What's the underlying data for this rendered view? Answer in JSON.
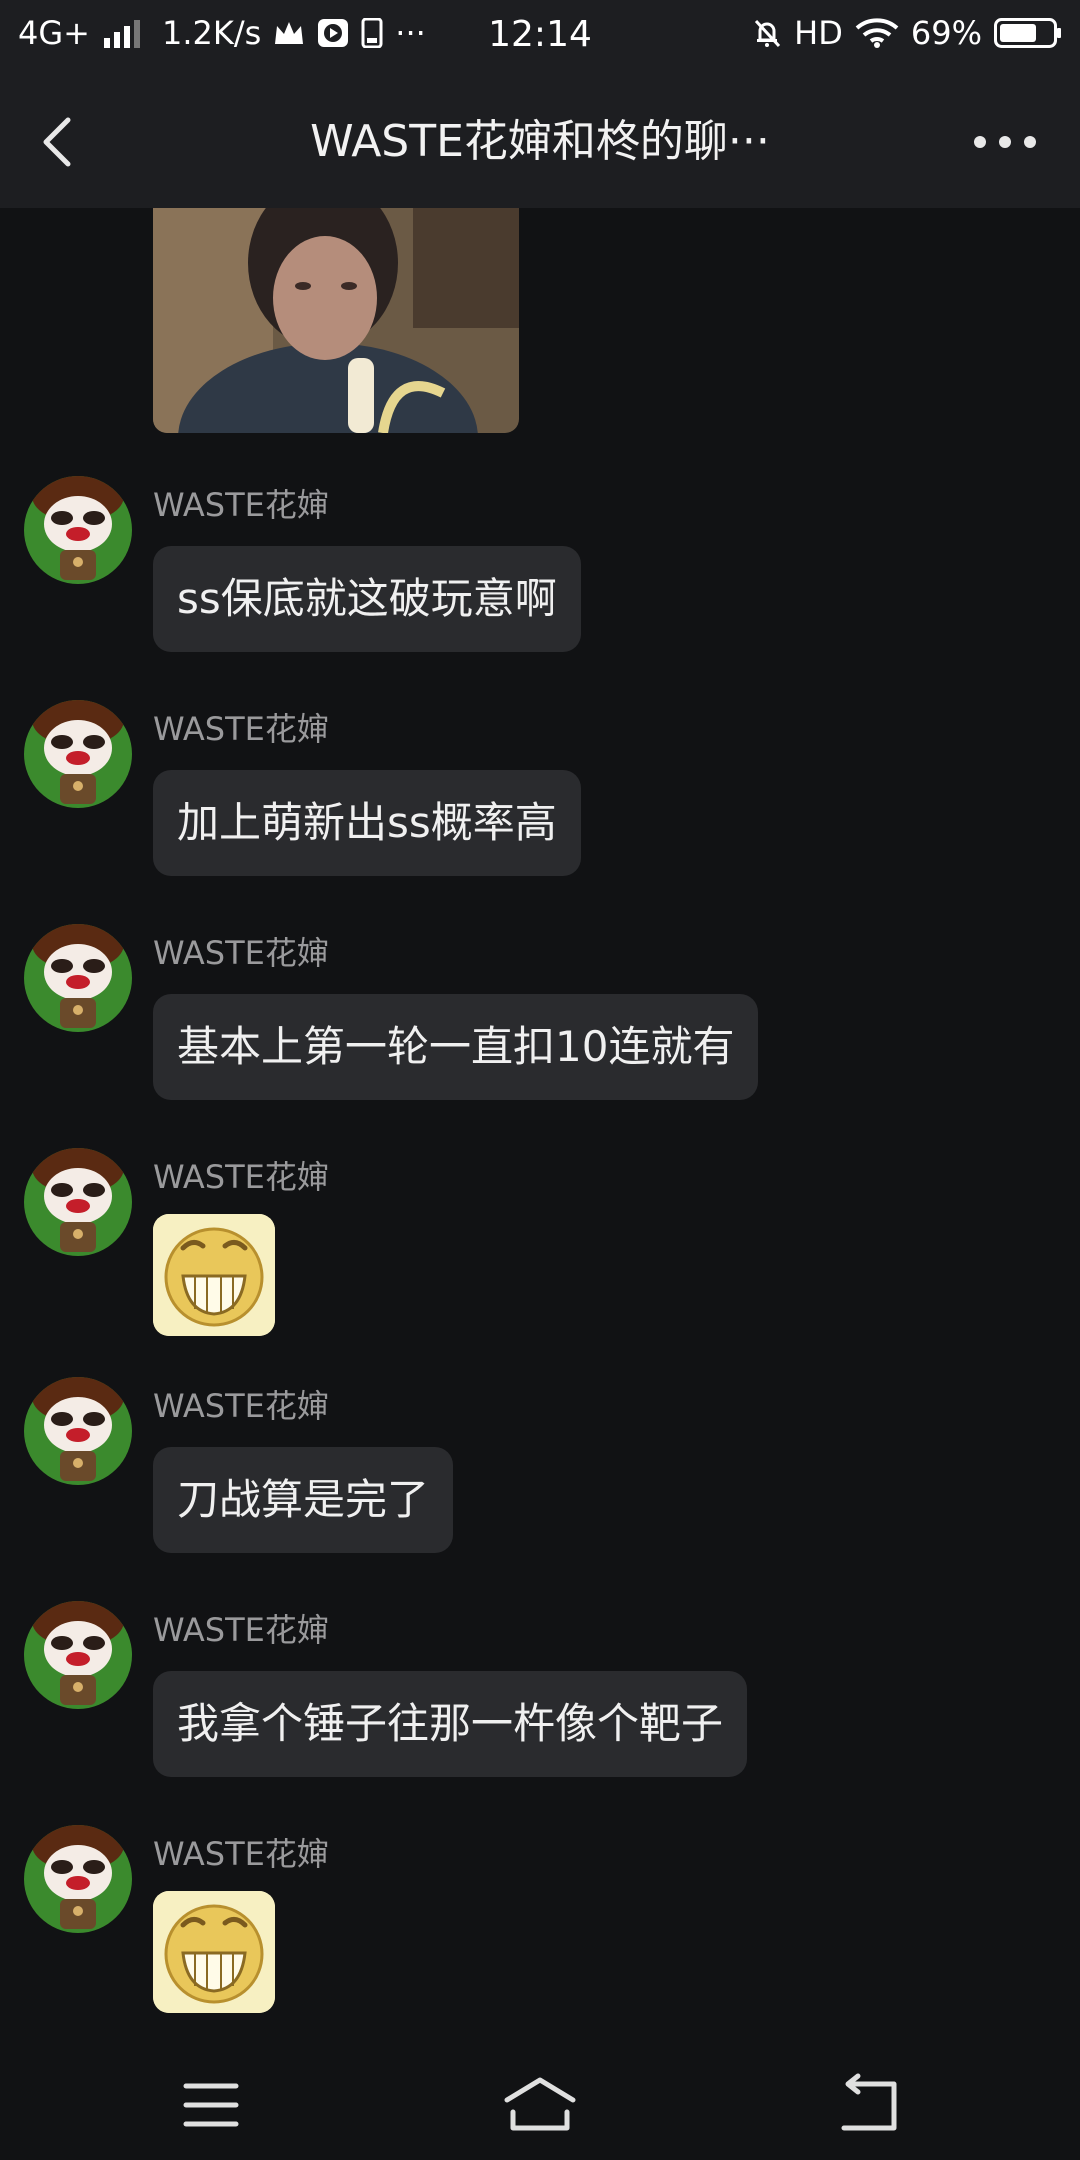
{
  "status_bar": {
    "network": "4G+",
    "speed": "1.2K/s",
    "overflow": "···",
    "time": "12:14",
    "hd": "HD",
    "battery": "69%",
    "battery_level": 0.69,
    "icons": [
      "signal-icon",
      "crown-icon",
      "media-play-icon",
      "phone-icon",
      "mute-bell-icon",
      "wifi-icon",
      "battery-icon"
    ]
  },
  "header": {
    "title": "WASTE花婶和柊的聊···",
    "back_icon": "back-chevron-icon",
    "more_icon": "more-dots-icon"
  },
  "messages": [
    {
      "type": "image",
      "desc": "photo"
    },
    {
      "sender": "WASTE花婶",
      "type": "text",
      "text": "ss保底就这破玩意啊"
    },
    {
      "sender": "WASTE花婶",
      "type": "text",
      "text": "加上萌新出ss概率高"
    },
    {
      "sender": "WASTE花婶",
      "type": "text",
      "text": "基本上第一轮一直扣10连就有"
    },
    {
      "sender": "WASTE花婶",
      "type": "sticker",
      "sticker": "grin-emoji"
    },
    {
      "sender": "WASTE花婶",
      "type": "text",
      "text": "刀战算是完了"
    },
    {
      "sender": "WASTE花婶",
      "type": "text",
      "text": "我拿个锤子往那一杵像个靶子"
    },
    {
      "sender": "WASTE花婶",
      "type": "sticker",
      "sticker": "grin-emoji"
    }
  ],
  "nav_bar": {
    "icons": [
      "menu-icon",
      "home-icon",
      "back-arrow-icon"
    ]
  }
}
